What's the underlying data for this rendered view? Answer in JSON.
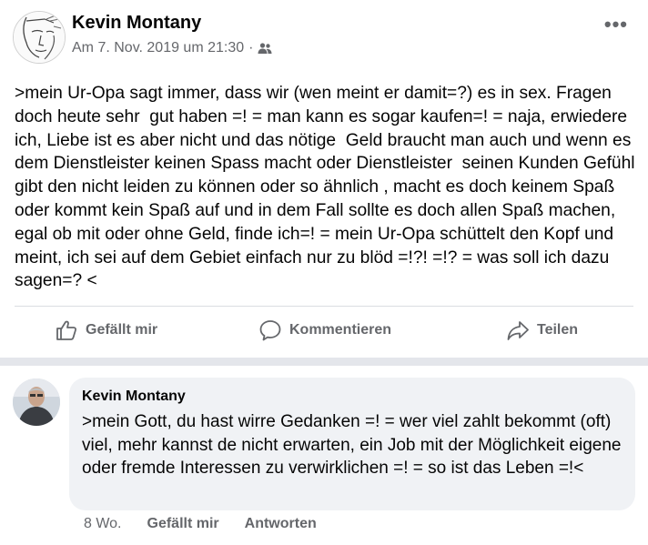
{
  "post": {
    "author": "Kevin Montany",
    "timestamp": "Am 7. Nov. 2019 um 21:30",
    "separator": "·",
    "audience_icon": "friends-icon",
    "more_icon": "more-options-icon",
    "more_label": "•••",
    "text": ">mein Ur-Opa sagt immer, dass wir (wen meint er damit=?) es in sex. Fragen doch heute sehr  gut haben =! = man kann es sogar kaufen=! = naja, erwiedere ich, Liebe ist es aber nicht und das nötige  Geld braucht man auch und wenn es dem Dienstleister keinen Spass macht oder Dienstleister  seinen Kunden Gefühl gibt den nicht leiden zu können oder so ähnlich , macht es doch keinem Spaß oder kommt kein Spaß auf und in dem Fall sollte es doch allen Spaß machen, egal ob mit oder ohne Geld, finde ich=! = mein Ur-Opa schüttelt den Kopf und meint, ich sei auf dem Gebiet einfach nur zu blöd =!?! =!? = was soll ich dazu sagen=? <"
  },
  "actions": {
    "like": {
      "label": "Gefällt mir",
      "icon": "thumbs-up-icon"
    },
    "comment": {
      "label": "Kommentieren",
      "icon": "comment-icon"
    },
    "share": {
      "label": "Teilen",
      "icon": "share-icon"
    }
  },
  "comment": {
    "author": "Kevin Montany",
    "text": ">mein Gott, du hast wirre Gedanken =! = wer viel zahlt bekommt (oft) viel, mehr kannst de nicht erwarten, ein Job mit der Möglichkeit eigene oder fremde Interessen zu verwirklichen =! = so ist das Leben =!<",
    "age": "8 Wo.",
    "like_label": "Gefällt mir",
    "reply_label": "Antworten"
  },
  "colors": {
    "text": "#050505",
    "secondary": "#65676b",
    "bubble": "#f0f2f5",
    "divider": "#dadde1"
  }
}
